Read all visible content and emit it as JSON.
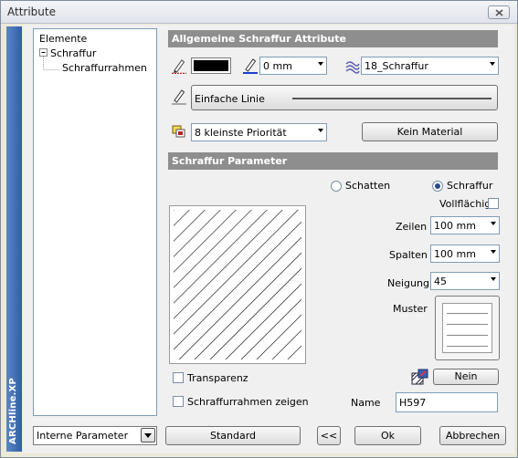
{
  "window": {
    "title": "Attribute"
  },
  "brand": "ARCHline.XP",
  "tree": {
    "root": "Elemente",
    "child": "Schraffur",
    "grandchild": "Schraffurrahmen"
  },
  "general": {
    "header": "Allgemeine Schraffur Attribute",
    "pen_width": "0 mm",
    "layer": "18_Schraffur",
    "line_type": "Einfache Linie",
    "priority": "8 kleinste Priorität",
    "material_button": "Kein Material",
    "colors": {
      "pen_color": "#000000",
      "accent": "#2f5ea8"
    }
  },
  "params": {
    "header": "Schraffur Parameter",
    "radio_shadow": "Schatten",
    "radio_hatch": "Schraffur",
    "selected": "Schraffur",
    "solid_label": "Vollflächig",
    "solid_checked": false,
    "rows_label": "Zeilen",
    "rows_value": "100 mm",
    "cols_label": "Spalten",
    "cols_value": "100 mm",
    "incline_label": "Neigung",
    "incline_value": "45",
    "pattern_label": "Muster",
    "transparency_label": "Transparenz",
    "transparency_checked": false,
    "frame_label": "Schraffurrahmen zeigen",
    "frame_checked": false,
    "no_button": "Nein",
    "name_label": "Name",
    "name_value": "H597"
  },
  "footer": {
    "internal_params": "Interne Parameter",
    "standard": "Standard",
    "back": "<<",
    "ok": "Ok",
    "cancel": "Abbrechen"
  }
}
